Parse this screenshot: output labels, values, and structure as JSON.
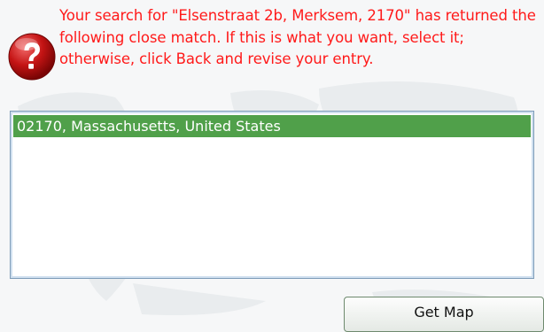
{
  "message": {
    "text": "Your search for \"Elsenstraat 2b, Merksem, 2170\" has returned the following close match. If this is what you want, select it; otherwise, click Back and revise your entry.",
    "color": "#ff1a1a",
    "icon": "question-icon"
  },
  "results": {
    "items": [
      {
        "label": "02170, Massachusetts, United States",
        "selected": true
      }
    ],
    "selected_color": "#50a04a"
  },
  "buttons": {
    "get_map_label": "Get Map"
  }
}
